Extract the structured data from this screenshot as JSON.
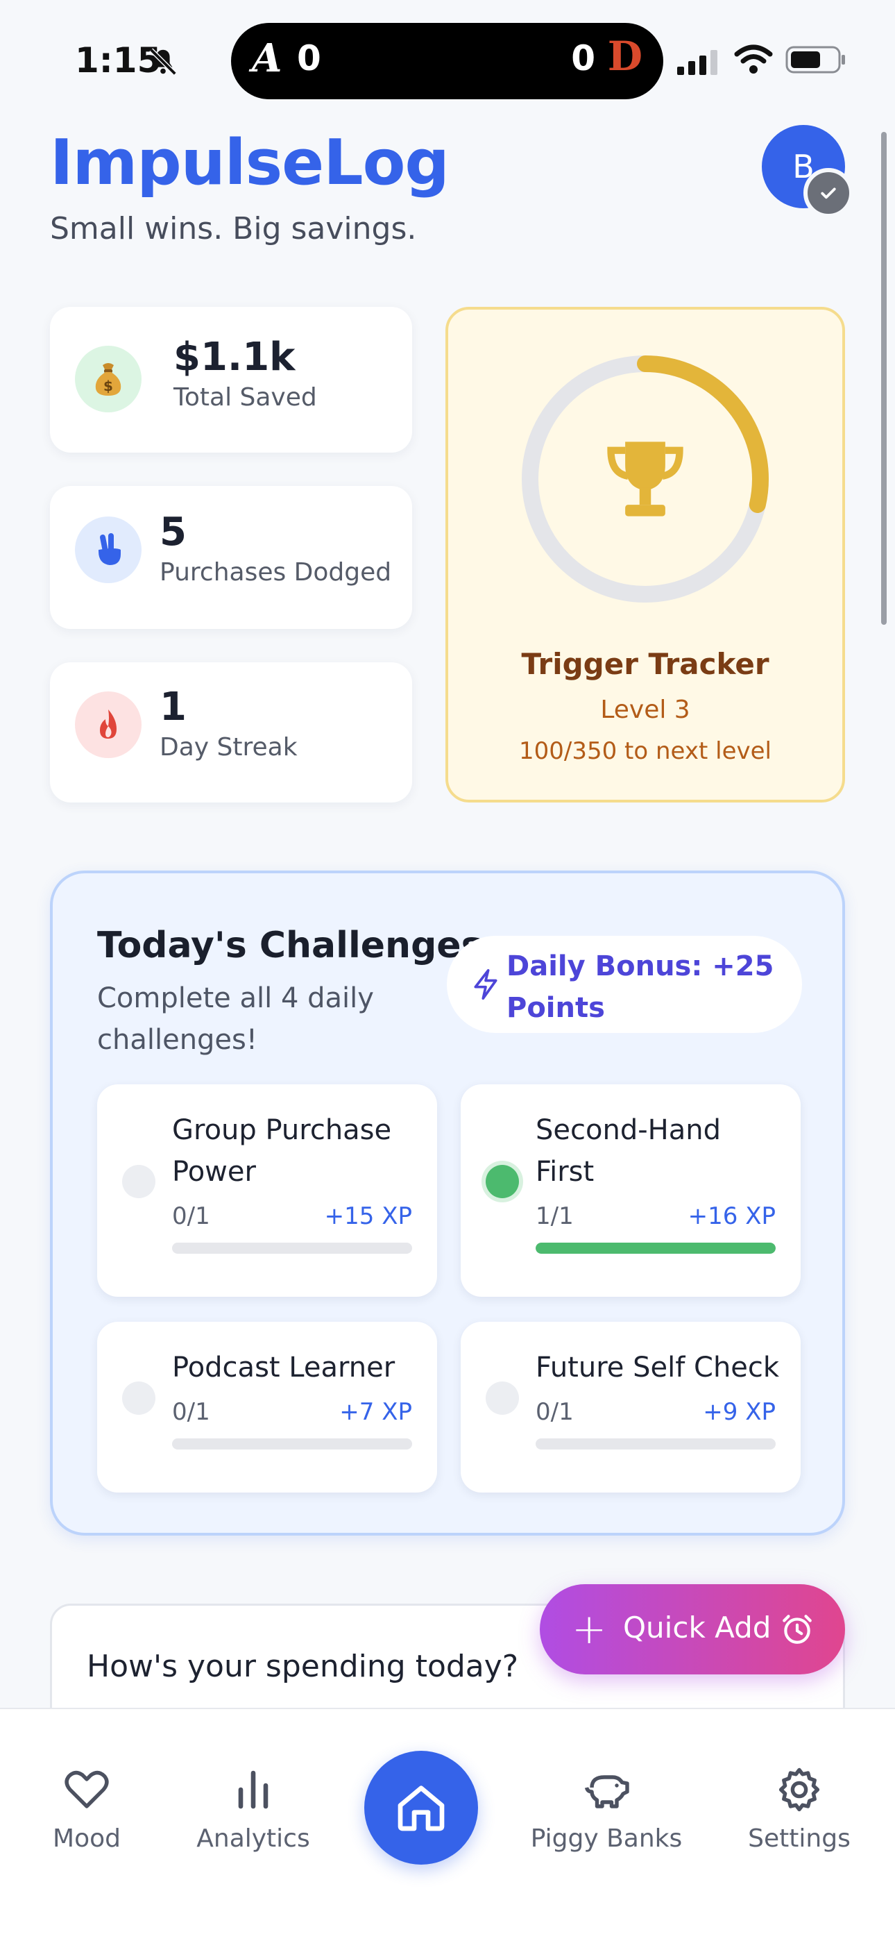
{
  "status_bar": {
    "time": "1:15",
    "score_left": "0",
    "score_right": "0",
    "team_left_logo": "A",
    "team_right_logo": "D"
  },
  "header": {
    "title": "ImpulseLog",
    "subtitle": "Small wins. Big savings.",
    "avatar_initial": "B"
  },
  "stats": [
    {
      "value": "$1.1k",
      "label": "Total Saved",
      "icon": "money-bag-icon",
      "bg": "#dcf5e3"
    },
    {
      "value": "5",
      "label": "Purchases Dodged",
      "icon": "hand-icon",
      "bg": "#e1ebfd"
    },
    {
      "value": "1",
      "label": "Day Streak",
      "icon": "flame-icon",
      "bg": "#fde2e2"
    }
  ],
  "tracker": {
    "title": "Trigger Tracker",
    "level": "Level 3",
    "progress_text": "100/350 to next level",
    "progress_fraction": 0.2857
  },
  "challenges": {
    "title": "Today's Challenges",
    "subtitle": "Complete all 4 daily challenges!",
    "bonus": "Daily Bonus: +25 Points",
    "items": [
      {
        "name": "Group Purchase Power",
        "progress": "0/1",
        "xp": "+15 XP",
        "fraction": 0,
        "done": false
      },
      {
        "name": "Second-Hand First",
        "progress": "1/1",
        "xp": "+16 XP",
        "fraction": 1,
        "done": true
      },
      {
        "name": "Podcast Learner",
        "progress": "0/1",
        "xp": "+7 XP",
        "fraction": 0,
        "done": false
      },
      {
        "name": "Future Self Check",
        "progress": "0/1",
        "xp": "+9 XP",
        "fraction": 0,
        "done": false
      }
    ]
  },
  "spending": {
    "prompt": "How's your spending today?"
  },
  "quick_add": {
    "label": "Quick Add"
  },
  "nav": {
    "items": [
      {
        "label": "Mood",
        "icon": "heart-icon"
      },
      {
        "label": "Analytics",
        "icon": "bar-chart-icon"
      },
      {
        "label": "",
        "icon": "home-icon"
      },
      {
        "label": "Piggy Banks",
        "icon": "piggy-bank-icon"
      },
      {
        "label": "Settings",
        "icon": "gear-icon"
      }
    ]
  },
  "colors": {
    "accent": "#3563e9",
    "success": "#4cba6e",
    "gold": "#e3b53a",
    "quick_add_start": "#b04de3",
    "quick_add_end": "#e0468f"
  }
}
